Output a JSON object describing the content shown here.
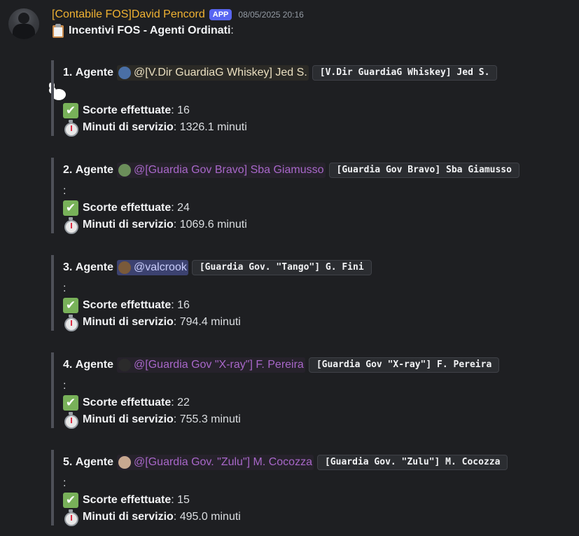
{
  "message": {
    "author": "[Contabile FOS]David Pencord",
    "app_tag": "APP",
    "timestamp": "08/05/2025 20:16",
    "title_icon": "clipboard-icon",
    "title": "Incentivi FOS - Agenti Ordinati",
    "title_suffix": ":"
  },
  "labels": {
    "agent_suffix": "Agente",
    "escorts_label": "Scorte effettuate",
    "minutes_label": "Minuti di servizio",
    "colon": ":"
  },
  "agents": [
    {
      "rank": "1.",
      "mention": "@[V.Dir GuardiaG Whiskey] Jed S.",
      "mention_color": "#eadfc0",
      "mention_bg": "#2b2a26",
      "avatar_color": "#4a6fa5",
      "code": "[V.Dir GuardiaG Whiskey] Jed S.",
      "has_colon_line": false,
      "escorts": "16",
      "minutes": "1326.1 minuti"
    },
    {
      "rank": "2.",
      "mention": "@[Guardia Gov Bravo] Sba Giamusso",
      "mention_color": "#a867c9",
      "mention_bg": "#26222b",
      "avatar_color": "#6b8e5a",
      "code": "[Guardia Gov Bravo] Sba Giamusso",
      "has_colon_line": true,
      "escorts": "24",
      "minutes": "1069.6 minuti"
    },
    {
      "rank": "3.",
      "mention": "@valcrook",
      "mention_color": "#c9cdfb",
      "mention_bg": "#3c4270",
      "avatar_color": "#7a5a3a",
      "code": "[Guardia Gov. \"Tango\"] G. Fini",
      "has_colon_line": true,
      "escorts": "16",
      "minutes": "794.4 minuti"
    },
    {
      "rank": "4.",
      "mention": "@[Guardia Gov \"X-ray\"] F. Pereira",
      "mention_color": "#a867c9",
      "mention_bg": "#26222b",
      "avatar_color": "#2b2b2b",
      "code": "[Guardia Gov \"X-ray\"] F. Pereira",
      "has_colon_line": true,
      "escorts": "22",
      "minutes": "755.3 minuti"
    },
    {
      "rank": "5.",
      "mention": "@[Guardia Gov. \"Zulu\"] M. Cocozza",
      "mention_color": "#a867c9",
      "mention_bg": "#26222b",
      "avatar_color": "#c8a890",
      "code": "[Guardia Gov. \"Zulu\"] M. Cocozza",
      "has_colon_line": true,
      "escorts": "15",
      "minutes": "495.0 minuti"
    }
  ]
}
